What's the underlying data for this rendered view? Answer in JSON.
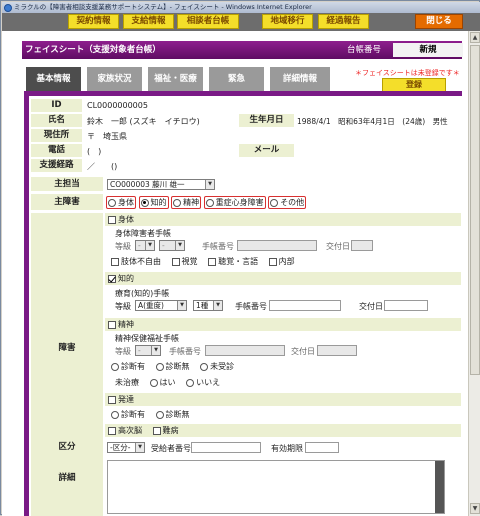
{
  "window": {
    "title": "ミラクルの【障害者相談支援業務サポートシステム】- フェイスシート - Windows Internet Explorer"
  },
  "topnav": {
    "items": [
      "契約情報",
      "支給情報",
      "相談者台帳",
      "地域移行",
      "経過報告"
    ],
    "close": "閉じる"
  },
  "sheet": {
    "title": "フェイスシート（支援対象者台帳）",
    "ledger_label": "台帳番号",
    "ledger_value": "新規"
  },
  "tabs": [
    "基本情報",
    "家族状況",
    "福祉・医療",
    "緊急",
    "詳細情報"
  ],
  "notice": "＊フェイスシートは未登録です＊",
  "register_btn": "登録",
  "person": {
    "id_label": "ID",
    "id": "CL0000000005",
    "name_label": "氏名",
    "name": "鈴木　一郎 (スズキ　イチロウ)",
    "birth_label": "生年月日",
    "birth": "1988/4/1　昭和63年4月1日　(24歳)　男性",
    "addr_label": "現住所",
    "addr": "〒　埼玉県",
    "phone_label": "電話",
    "phone": "(　)",
    "mail_label": "メール",
    "route_label": "支援経路",
    "route": "／　　()"
  },
  "staff": {
    "label": "主担当",
    "value": "CO000003 藤川 雄一"
  },
  "disability_main": {
    "label": "主障害",
    "options": [
      "身体",
      "知的",
      "精神",
      "重症心身障害",
      "その他"
    ],
    "selected": "知的"
  },
  "disability": {
    "label": "障害",
    "physical": {
      "label": "身体",
      "checked": false,
      "handbook": "身体障害者手帳",
      "grade": "等級",
      "grade_sel1": "-",
      "grade_sel2": "-",
      "num": "手帳番号",
      "issued": "交付日",
      "items": [
        "肢体不自由",
        "視覚",
        "聴覚・言語",
        "内部"
      ]
    },
    "intellectual": {
      "label": "知的",
      "checked": true,
      "handbook": "療育(知的)手帳",
      "grade": "等級",
      "grade_sel1": "A(重度)",
      "grade_sel2": "1種",
      "num": "手帳番号",
      "issued": "交付日"
    },
    "mental": {
      "label": "精神",
      "checked": false,
      "handbook": "精神保健福祉手帳",
      "grade": "等級",
      "grade_sel": "-",
      "num": "手帳番号",
      "issued": "交付日",
      "diag": [
        "診断有",
        "診断無",
        "未受診"
      ],
      "untreated": "未治療",
      "yesno": [
        "はい",
        "いいえ"
      ]
    },
    "developmental": {
      "label": "発達",
      "checked": false,
      "diag": [
        "診断有",
        "診断無"
      ]
    },
    "higher": {
      "label": "高次脳",
      "checked": false
    },
    "intractable": {
      "label": "難病",
      "checked": false
    }
  },
  "category": {
    "label": "区分",
    "select": "-区分-",
    "recipient": "受給者番号",
    "valid": "有効期限"
  },
  "detail": {
    "label": "詳細"
  }
}
